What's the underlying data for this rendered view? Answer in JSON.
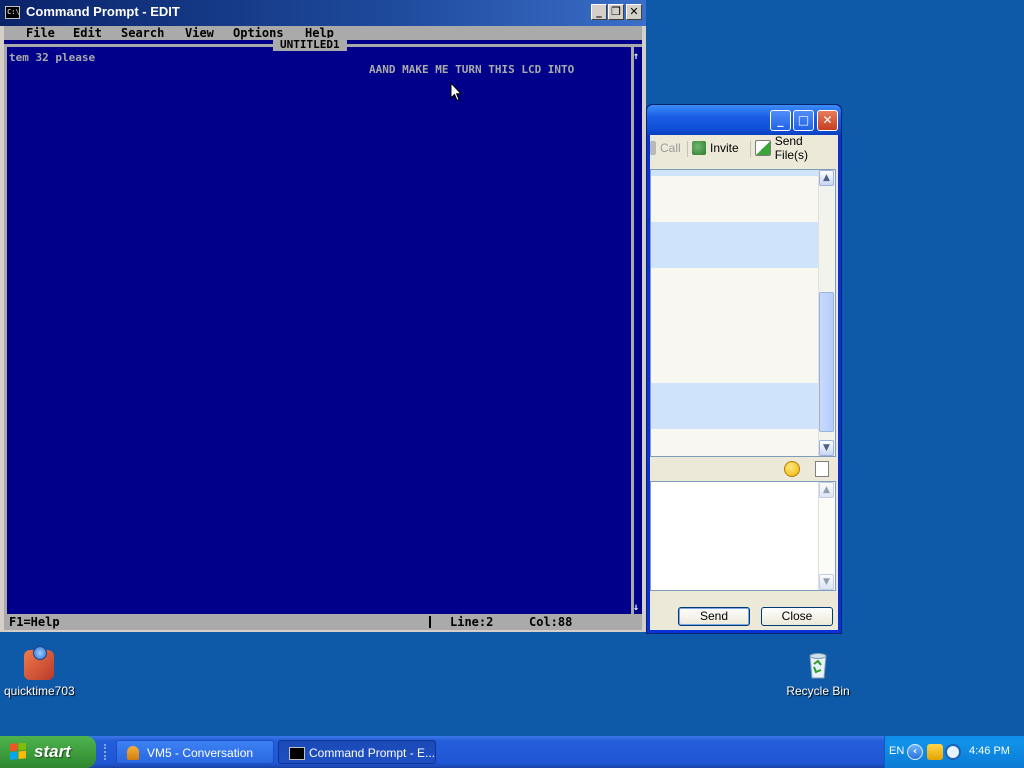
{
  "cmd_window": {
    "title": "Command Prompt - EDIT",
    "icon_label": "C:\\",
    "controls": {
      "minimize": "_",
      "restore": "❐",
      "close": "✕"
    },
    "menu": [
      "File",
      "Edit",
      "Search",
      "View",
      "Options",
      "Help"
    ],
    "document_title": "UNTITLED1",
    "text_line1": "tem 32 please",
    "text_line2": "AAND MAKE ME TURN THIS LCD INTO",
    "status_help": "F1=Help",
    "status_line": "Line:2",
    "status_col": "Col:88"
  },
  "messenger_window": {
    "toolbar": {
      "call": "Call",
      "invite": "Invite",
      "send_files": "Send File(s)"
    },
    "send_label": "Send",
    "close_label": "Close",
    "controls": {
      "minimize": "_",
      "maximize": "□",
      "close": "✕"
    }
  },
  "desktop_icons": {
    "quicktime": "quicktime703",
    "recycle_bin": "Recycle Bin"
  },
  "taskbar": {
    "start_label": "start",
    "tasks": [
      {
        "label": "VM5 - Conversation"
      },
      {
        "label": "Command Prompt - E..."
      }
    ],
    "language": "EN",
    "clock": "4:46 PM"
  }
}
